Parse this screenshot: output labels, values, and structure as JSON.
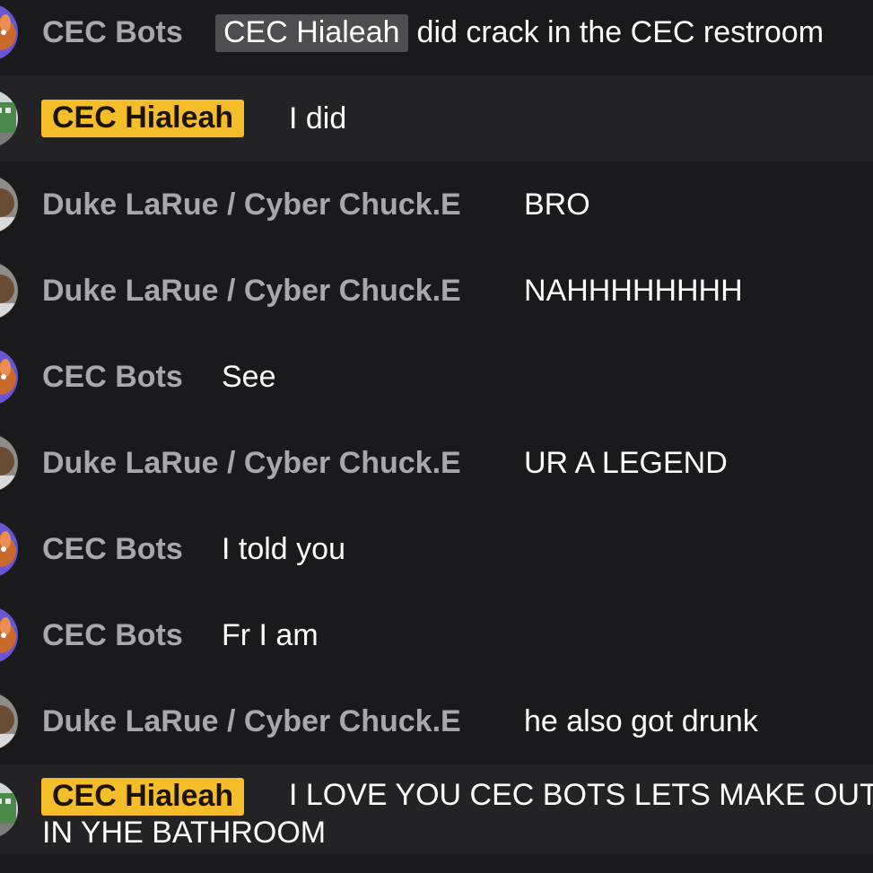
{
  "messages": [
    {
      "user": "CEC Bots",
      "mention": "CEC Hialeah",
      "text": "did crack in the CEC restroom"
    },
    {
      "user": "CEC Hialeah",
      "text": "I did"
    },
    {
      "user": "Duke LaRue / Cyber Chuck.E",
      "text": "BRO"
    },
    {
      "user": "Duke LaRue / Cyber Chuck.E",
      "text": "NAHHHHHHHH"
    },
    {
      "user": "CEC Bots",
      "text": "See"
    },
    {
      "user": "Duke LaRue / Cyber Chuck.E",
      "text": "UR A LEGEND"
    },
    {
      "user": "CEC Bots",
      "text": "I told you"
    },
    {
      "user": "CEC Bots",
      "text": "Fr I am"
    },
    {
      "user": "Duke LaRue / Cyber Chuck.E",
      "text": "he also got drunk"
    },
    {
      "user": "CEC Hialeah",
      "text": "I LOVE YOU CEC BOTS LETS MAKE OUT",
      "text_line2": "IN YHE BATHROOM"
    }
  ],
  "colors": {
    "background": "#1a1a1c",
    "highlight_row": "#232325",
    "badge": "#f6bd2a",
    "mention_bg": "#4d4d52",
    "username": "#a8a8ac"
  },
  "icons": {
    "bots_avatar": "mascot-avatar-icon",
    "hialeah_avatar": "building-avatar-icon",
    "duke_avatar": "character-avatar-icon"
  }
}
